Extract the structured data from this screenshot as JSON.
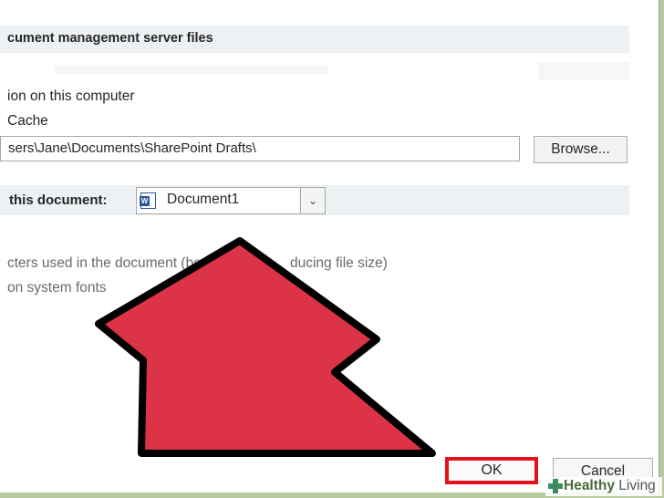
{
  "section_header": "cument management server files",
  "location_label": "ion on this computer",
  "cache_label": "Cache",
  "path_value": "sers\\Jane\\Documents\\SharePoint Drafts\\",
  "browse_label": "Browse...",
  "document_row": {
    "label": "this document:",
    "icon_letter": "W",
    "selected": "Document1"
  },
  "option1": "cters used in the document (best f",
  "option1_tail": "ducing file size)",
  "option2": "on system fonts",
  "buttons": {
    "ok": "OK",
    "cancel": "Cancel"
  },
  "watermark": {
    "brand": "Healthy",
    "rest": " Living"
  },
  "colors": {
    "arrow_fill": "#dd3346",
    "highlight": "#e8101a",
    "frame": "#b9c99e"
  }
}
